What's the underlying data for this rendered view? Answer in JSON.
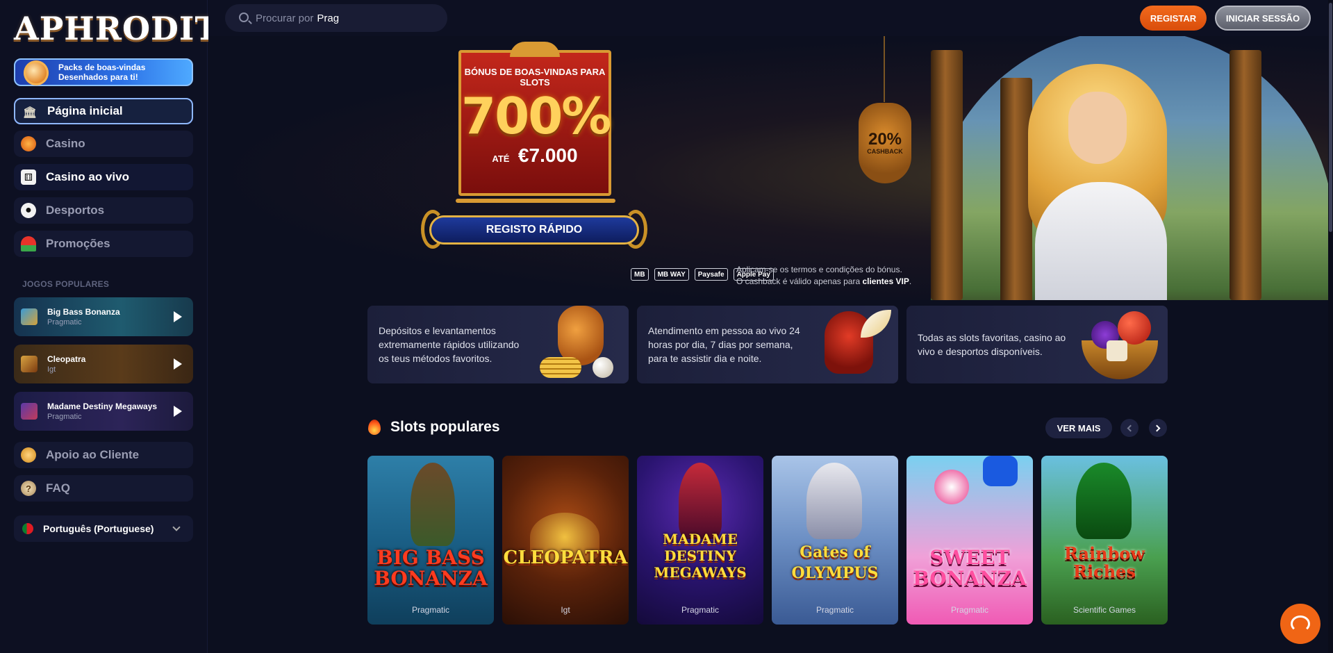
{
  "app": {
    "logo_text": "APHRODITE"
  },
  "header": {
    "search_placeholder": "Procurar por",
    "search_value": "Prag",
    "register_label": "REGISTAR",
    "login_label": "INICIAR SESSÃO"
  },
  "sidebar": {
    "welcome_pack": {
      "line1": "Packs de boas-vindas",
      "line2": "Desenhados para ti!"
    },
    "nav": [
      {
        "label": "Página inicial",
        "icon": "temple-icon"
      },
      {
        "label": "Casino",
        "icon": "chip-icon"
      },
      {
        "label": "Casino ao vivo",
        "icon": "dice-icon"
      },
      {
        "label": "Desportos",
        "icon": "football-icon"
      },
      {
        "label": "Promoções",
        "icon": "watermelon-icon"
      }
    ],
    "popular_title": "JOGOS POPULARES",
    "popular_games": [
      {
        "name": "Big Bass Bonanza",
        "provider": "Pragmatic"
      },
      {
        "name": "Cleopatra",
        "provider": "Igt"
      },
      {
        "name": "Madame Destiny Megaways",
        "provider": "Pragmatic"
      }
    ],
    "support": [
      {
        "label": "Apoio ao Cliente",
        "icon": "headset-icon"
      },
      {
        "label": "FAQ",
        "icon": "question-icon"
      }
    ],
    "language": "Português (Portuguese)"
  },
  "hero": {
    "bonus_sub": "BÓNUS DE BOAS-VINDAS PARA SLOTS",
    "bonus_big": "700%",
    "bonus_upto": "ATÉ",
    "bonus_amount": "€7.000",
    "cashback_pct": "20%",
    "cashback_label": "CASHBACK",
    "cta_label": "REGISTO RÁPIDO",
    "payments": [
      "MB",
      "MB WAY",
      "Paysafe",
      "Apple Pay"
    ],
    "terms_line1": "Aplicam-se os termos e condições do bónus.",
    "terms_line2_prefix": "O cashback é válido apenas para ",
    "terms_line2_bold": "clientes VIP",
    "terms_line2_suffix": "."
  },
  "features": [
    {
      "text": "Depósitos e levantamentos extremamente rápidos utilizando os teus métodos favoritos."
    },
    {
      "text": "Atendimento em pessoa ao vivo 24 horas por dia, 7 dias por semana, para te assistir dia e noite."
    },
    {
      "text": "Todas as slots favoritas, casino ao vivo e desportos disponíveis."
    }
  ],
  "slots": {
    "title": "Slots populares",
    "see_more": "VER MAIS",
    "games": [
      {
        "title": "BIG BASS BONANZA",
        "provider": "Pragmatic"
      },
      {
        "title": "CLEOPATRA",
        "provider": "Igt"
      },
      {
        "title": "MADAME DESTINY MEGAWAYS",
        "provider": "Pragmatic"
      },
      {
        "title": "Gates of OLYMPUS",
        "provider": "Pragmatic"
      },
      {
        "title": "SWEET BONANZA",
        "provider": "Pragmatic"
      },
      {
        "title": "Rainbow Riches",
        "provider": "Scientific Games"
      }
    ]
  },
  "colors": {
    "accent_orange": "#f06515",
    "bg": "#0c0f1f",
    "active_border": "#8fb8ff"
  }
}
